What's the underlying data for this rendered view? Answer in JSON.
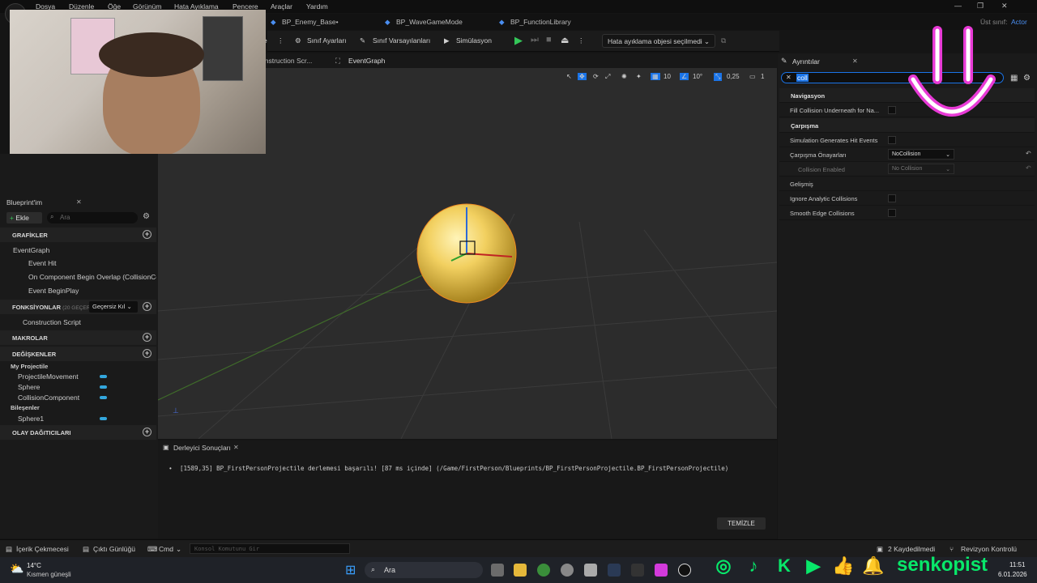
{
  "menu": [
    "Dosya",
    "Düzenle",
    "Öğe",
    "Görünüm",
    "Hata Ayıklama",
    "Pencere",
    "Araçlar",
    "Yardım"
  ],
  "tabs": [
    "BP_Enemy_Base•",
    "BP_WaveGameMode",
    "BP_FunctionLibrary"
  ],
  "parent_class": {
    "label": "Üst sınıf:",
    "value": "Actor"
  },
  "toolbar": {
    "class_settings": "Sınıf Ayarları",
    "class_defaults": "Sınıf Varsayılanları",
    "simulation": "Simülasyon",
    "debug_object": "Hata ayıklama objesi seçilmedi",
    "compile_stub": "e"
  },
  "subtabs": [
    "onstruction Scr...",
    "EventGraph"
  ],
  "viewport": {
    "grid_snap": "10",
    "rot_snap": "10°",
    "scale_snap": "0,25",
    "camera_speed": "1"
  },
  "my_blueprint": {
    "title": "Blueprint'im",
    "add": "Ekle",
    "search_placeholder": "Ara",
    "graphs_header": "GRAFİKLER",
    "event_graph": "EventGraph",
    "events": [
      "Event Hit",
      "On Component Begin Overlap (CollisionCo",
      "Event BeginPlay"
    ],
    "functions_header": "FONKSİYONLAR",
    "functions_note": "(20 GEÇERS",
    "override": "Geçersiz Kıl",
    "construction_script": "Construction Script",
    "macros_header": "MAKROLAR",
    "variables_header": "DEĞİŞKENLER",
    "var_group": "My Projectile",
    "variables": [
      "ProjectileMovement",
      "Sphere",
      "CollisionComponent"
    ],
    "components_group": "Bileşenler",
    "components": [
      "Sphere1"
    ],
    "dispatchers_header": "OLAY DAĞITICILARI"
  },
  "details": {
    "title": "Ayrıntılar",
    "search_value": "coll",
    "nav_header": "Navigasyon",
    "fill_collision": "Fill Collision Underneath for Na...",
    "collision_header": "Çarpışma",
    "sim_hit": "Simulation Generates Hit Events",
    "presets_label": "Çarpışma Önayarları",
    "presets_value": "NoCollision",
    "coll_enabled_label": "Collision Enabled",
    "coll_enabled_value": "No Collision",
    "advanced_header": "Gelişmiş",
    "ignore_analytic": "Ignore Analytic Collisions",
    "smooth_edge": "Smooth Edge Collisions"
  },
  "console": {
    "tab": "Derleyici Sonuçları",
    "message": "[1589,35] BP_FirstPersonProjectile derlemesi başarılı! [87 ms içinde] (/Game/FirstPerson/Blueprints/BP_FirstPersonProjectile.BP_FirstPersonProjectile)",
    "clear": "TEMİZLE"
  },
  "statusbar": {
    "content_drawer": "İçerik Çekmecesi",
    "output_log": "Çıktı Günlüğü",
    "cmd": "Cmd",
    "console_placeholder": "Konsol Komutunu Gir",
    "saved": "2 Kaydedilmedi",
    "revision": "Revizyon Kontrolü"
  },
  "taskbar": {
    "temp": "14°C",
    "weather": "Kısmen güneşli",
    "search": "Ara",
    "time": "11:51",
    "date": "6.01.2026"
  },
  "overlay": {
    "brand": "senkopist"
  },
  "colors": {
    "accent": "#1a74e8",
    "play_green": "#34c759",
    "social_green": "#08e86a",
    "smile_pink": "#e83ad6",
    "sphere": "#f2d060"
  }
}
